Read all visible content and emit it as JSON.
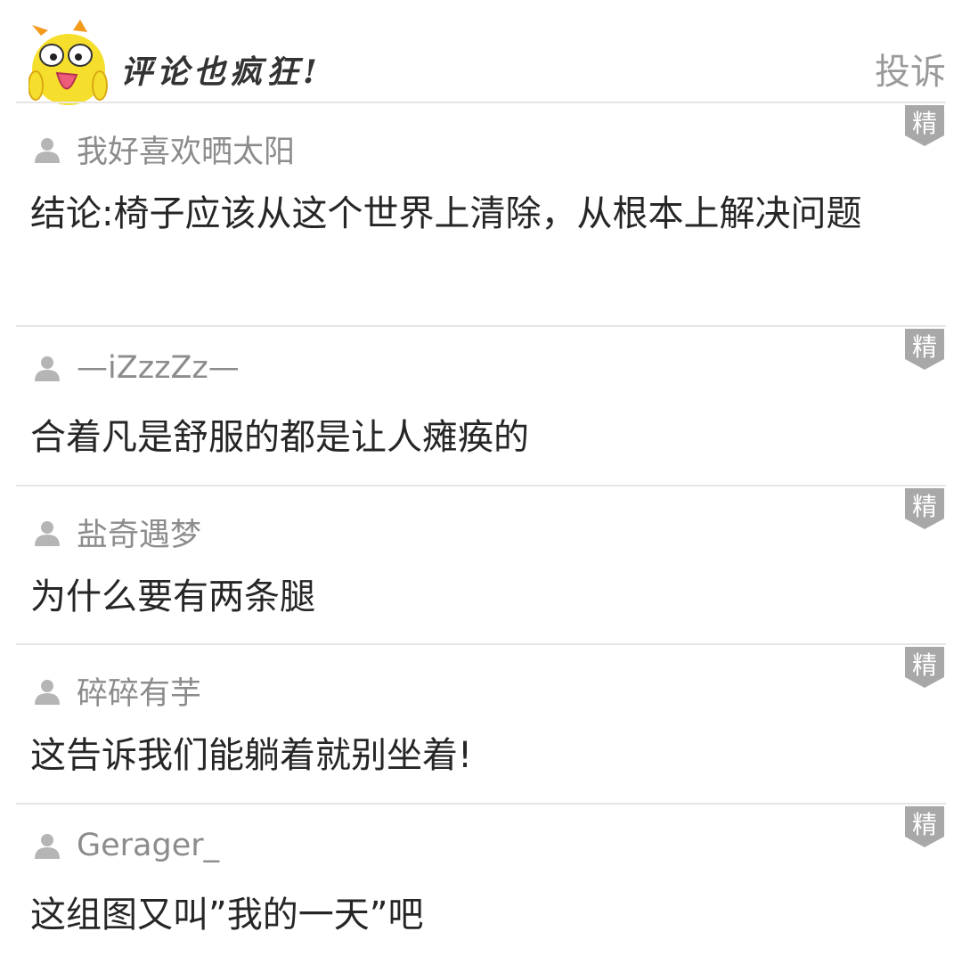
{
  "header": {
    "title": "评论也疯狂!",
    "report_label": "投诉"
  },
  "badge_label": "精",
  "comments": [
    {
      "username": "我好喜欢晒太阳",
      "text": "结论:椅子应该从这个世界上清除，从根本上解决问题"
    },
    {
      "username": "—iZzzZz—",
      "text": "合着凡是舒服的都是让人瘫痪的"
    },
    {
      "username": "盐奇遇梦",
      "text": "为什么要有两条腿"
    },
    {
      "username": "碎碎有芋",
      "text": "这告诉我们能躺着就别坐着!"
    },
    {
      "username": "Gerager_",
      "text": "这组图又叫”我的一天”吧"
    }
  ],
  "colors": {
    "badge": "#a8a8a8",
    "divider": "#e6e6e6",
    "username": "#8c8c8c",
    "content": "#262626",
    "mascot": "#f6df2c"
  }
}
